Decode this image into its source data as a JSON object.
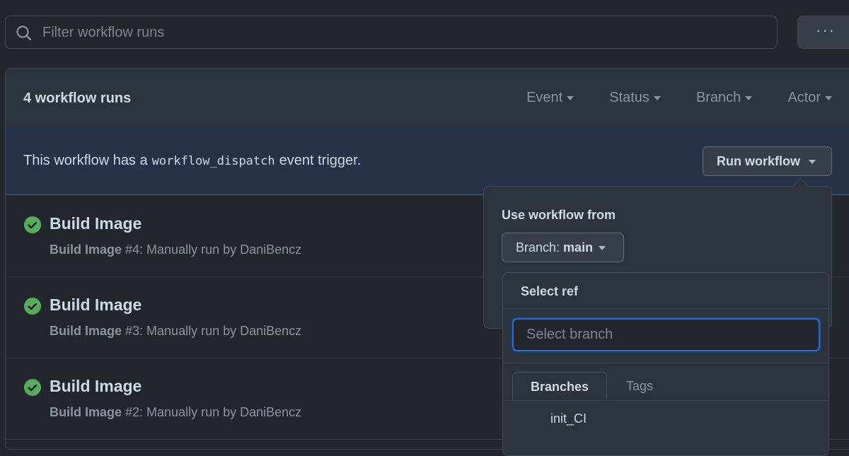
{
  "search": {
    "placeholder": "Filter workflow runs",
    "icon": "search-icon"
  },
  "more_button": {
    "label": "···",
    "icon": "kebab-horizontal-icon"
  },
  "runs_header": {
    "count_label": "4 workflow runs",
    "filters": [
      {
        "label": "Event"
      },
      {
        "label": "Status"
      },
      {
        "label": "Branch"
      },
      {
        "label": "Actor"
      }
    ]
  },
  "banner": {
    "prefix": "This workflow has a",
    "code": "workflow_dispatch",
    "suffix": "event trigger.",
    "run_button": "Run workflow"
  },
  "runs": [
    {
      "title": "Build Image",
      "workflow": "Build Image",
      "detail": " #4: Manually run by DaniBencz",
      "status": "success"
    },
    {
      "title": "Build Image",
      "workflow": "Build Image",
      "detail": " #3: Manually run by DaniBencz",
      "status": "success"
    },
    {
      "title": "Build Image",
      "workflow": "Build Image",
      "detail": " #2: Manually run by DaniBencz",
      "status": "success"
    }
  ],
  "popover": {
    "label": "Use workflow from",
    "branch_prefix": "Branch: ",
    "branch_value": "main",
    "ref_panel": {
      "title": "Select ref",
      "search_placeholder": "Select branch",
      "tabs": [
        {
          "label": "Branches",
          "active": true
        },
        {
          "label": "Tags",
          "active": false
        }
      ],
      "items": [
        "init_CI"
      ]
    }
  },
  "colors": {
    "success": "#57ab5a",
    "focus": "#316dca",
    "banner_bg": "#253247"
  }
}
